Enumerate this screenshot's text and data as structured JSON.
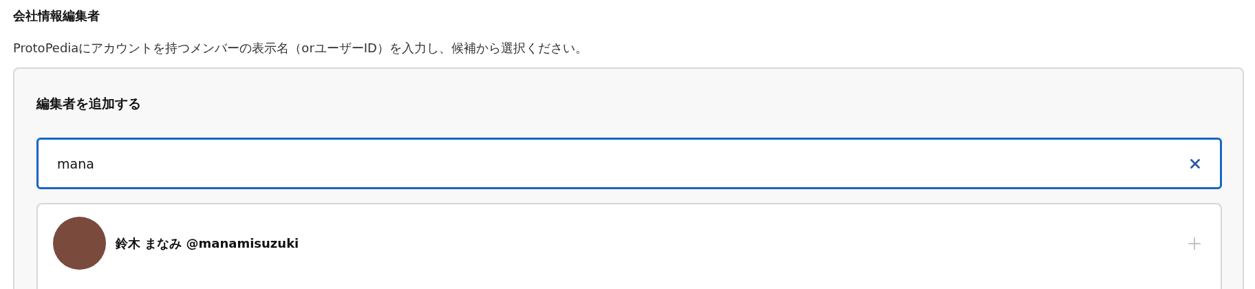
{
  "section": {
    "title": "会社情報編集者",
    "description": "ProtoPediaにアカウントを持つメンバーの表示名（orユーザーID）を入力し、候補から選択ください。"
  },
  "panel": {
    "title": "編集者を追加する",
    "search": {
      "value": "mana",
      "focused": true
    },
    "results": [
      {
        "label": "鈴木 まなみ @manamisuzuki"
      }
    ]
  }
}
